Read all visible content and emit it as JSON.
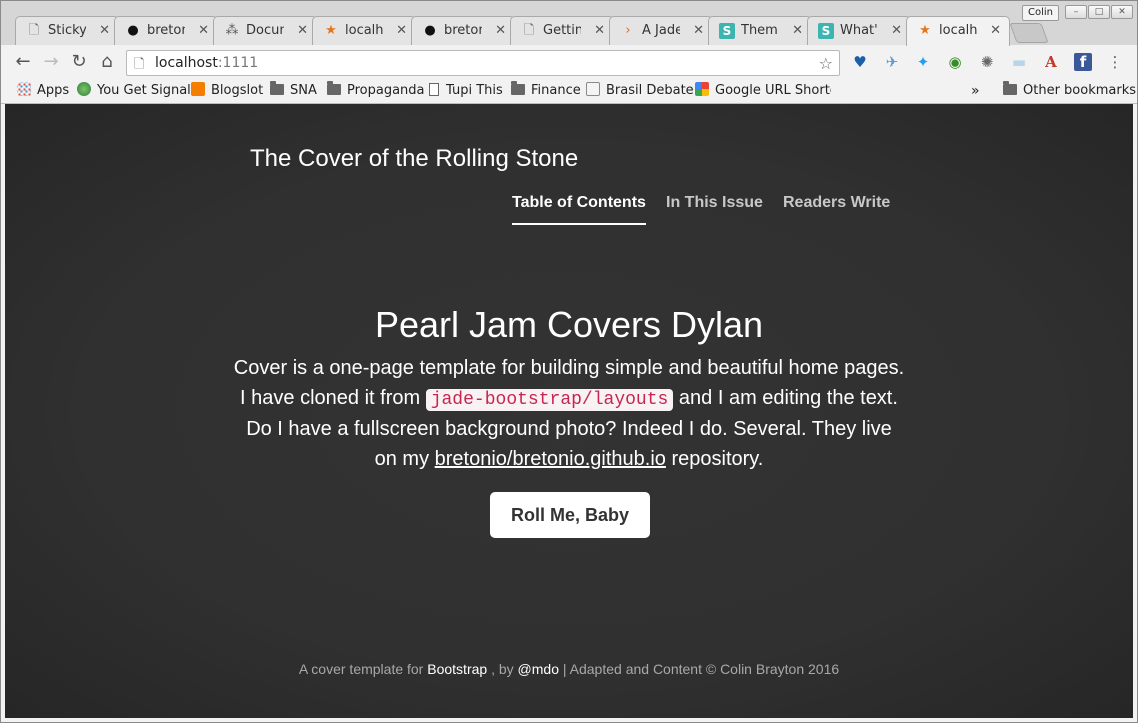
{
  "browser": {
    "profile_name": "Colin",
    "tabs": [
      {
        "title": "Sticky f",
        "icon": "page-icon"
      },
      {
        "title": "bretoni",
        "icon": "github-icon"
      },
      {
        "title": "Docum",
        "icon": "docs-icon"
      },
      {
        "title": "localho",
        "icon": "star-icon"
      },
      {
        "title": "bretoni",
        "icon": "github-icon"
      },
      {
        "title": "Getting",
        "icon": "page-icon"
      },
      {
        "title": "A Jade",
        "icon": "jade-icon"
      },
      {
        "title": "Themin",
        "icon": "s-icon"
      },
      {
        "title": "What's",
        "icon": "s-icon"
      },
      {
        "title": "localho",
        "icon": "star-icon"
      }
    ],
    "url_host": "localhost",
    "url_port": ":1111",
    "bookmarks": [
      {
        "label": "Apps",
        "icon": "apps-icon"
      },
      {
        "label": "You Get Signal",
        "icon": "globe-icon"
      },
      {
        "label": "Blogslot",
        "icon": "blogger-icon"
      },
      {
        "label": "SNA",
        "icon": "folder-icon"
      },
      {
        "label": "Propaganda",
        "icon": "folder-icon"
      },
      {
        "label": "Tupi This",
        "icon": "page-icon"
      },
      {
        "label": "Finance",
        "icon": "folder-icon"
      },
      {
        "label": "Brasil Debate",
        "icon": "brd-icon"
      },
      {
        "label": "Google URL Shortener",
        "icon": "google-icon"
      }
    ],
    "overflow_label": "»",
    "other_bookmarks": "Other bookmarks"
  },
  "page": {
    "brand": "The Cover of the Rolling Stone",
    "nav": [
      "Table of Contents",
      "In This Issue",
      "Readers Write"
    ],
    "headline": "Pearl Jam Covers Dylan",
    "lead_part1": "Cover is a one-page template for building simple and beautiful home pages. I have cloned it from ",
    "lead_code": "jade-bootstrap/layouts",
    "lead_part2": " and I am editing the text. Do I have a fullscreen background photo? Indeed I do. Several. They live on my ",
    "lead_link": "bretonio/bretonio.github.io",
    "lead_part3": " repository.",
    "button": "Roll Me, Baby",
    "footer_part1": "A cover template for ",
    "footer_link1": "Bootstrap",
    "footer_part2": " , by ",
    "footer_link2": "@mdo",
    "footer_part3": " | Adapted and Content © Colin Brayton 2016"
  },
  "colors": {
    "background": "#303030",
    "code_text": "#c7254e",
    "code_bg": "#f9f2f4"
  }
}
